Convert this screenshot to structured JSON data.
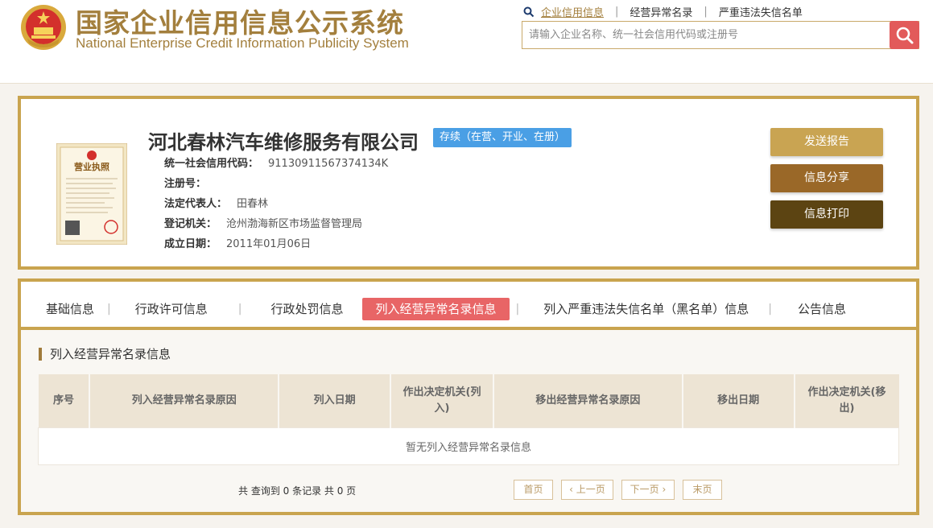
{
  "site": {
    "title_cn": "国家企业信用信息公示系统",
    "title_en": "National Enterprise Credit Information Publicity System"
  },
  "top_nav": {
    "links": [
      "企业信用信息",
      "经营异常名录",
      "严重违法失信名单"
    ],
    "active_index": 0
  },
  "search": {
    "placeholder": "请输入企业名称、统一社会信用代码或注册号"
  },
  "company": {
    "name": "河北春林汽车维修服务有限公司",
    "status": "存续（在营、开业、在册）",
    "license_image_text": "营业执照",
    "fields": [
      {
        "label": "统一社会信用代码：",
        "value": "91130911567374134K"
      },
      {
        "label": "注册号：",
        "value": ""
      },
      {
        "label": "法定代表人：",
        "value": "田春林"
      },
      {
        "label": "登记机关：",
        "value": "沧州渤海新区市场监督管理局"
      },
      {
        "label": "成立日期：",
        "value": "2011年01月06日"
      }
    ]
  },
  "actions": {
    "send_report": "发送报告",
    "share": "信息分享",
    "print": "信息打印"
  },
  "tabs": [
    "基础信息",
    "行政许可信息",
    "行政处罚信息",
    "列入经营异常名录信息",
    "列入严重违法失信名单（黑名单）信息",
    "公告信息"
  ],
  "active_tab": 3,
  "section": {
    "title": "列入经营异常名录信息",
    "columns": [
      "序号",
      "列入经营异常名录原因",
      "列入日期",
      "作出决定机关(列入)",
      "移出经营异常名录原因",
      "移出日期",
      "作出决定机关(移出)"
    ],
    "empty_text": "暂无列入经营异常名录信息"
  },
  "pagination": {
    "summary": "共 查询到 0 条记录 共 0 页",
    "first": "首页",
    "prev": "上一页",
    "next": "下一页",
    "last": "末页"
  },
  "colors": {
    "gold_border": "#c9a44f",
    "title_gold": "#a37f3d",
    "active_tab": "#e86566",
    "status_blue": "#4a9fe5",
    "search_button": "#e25a5a"
  }
}
